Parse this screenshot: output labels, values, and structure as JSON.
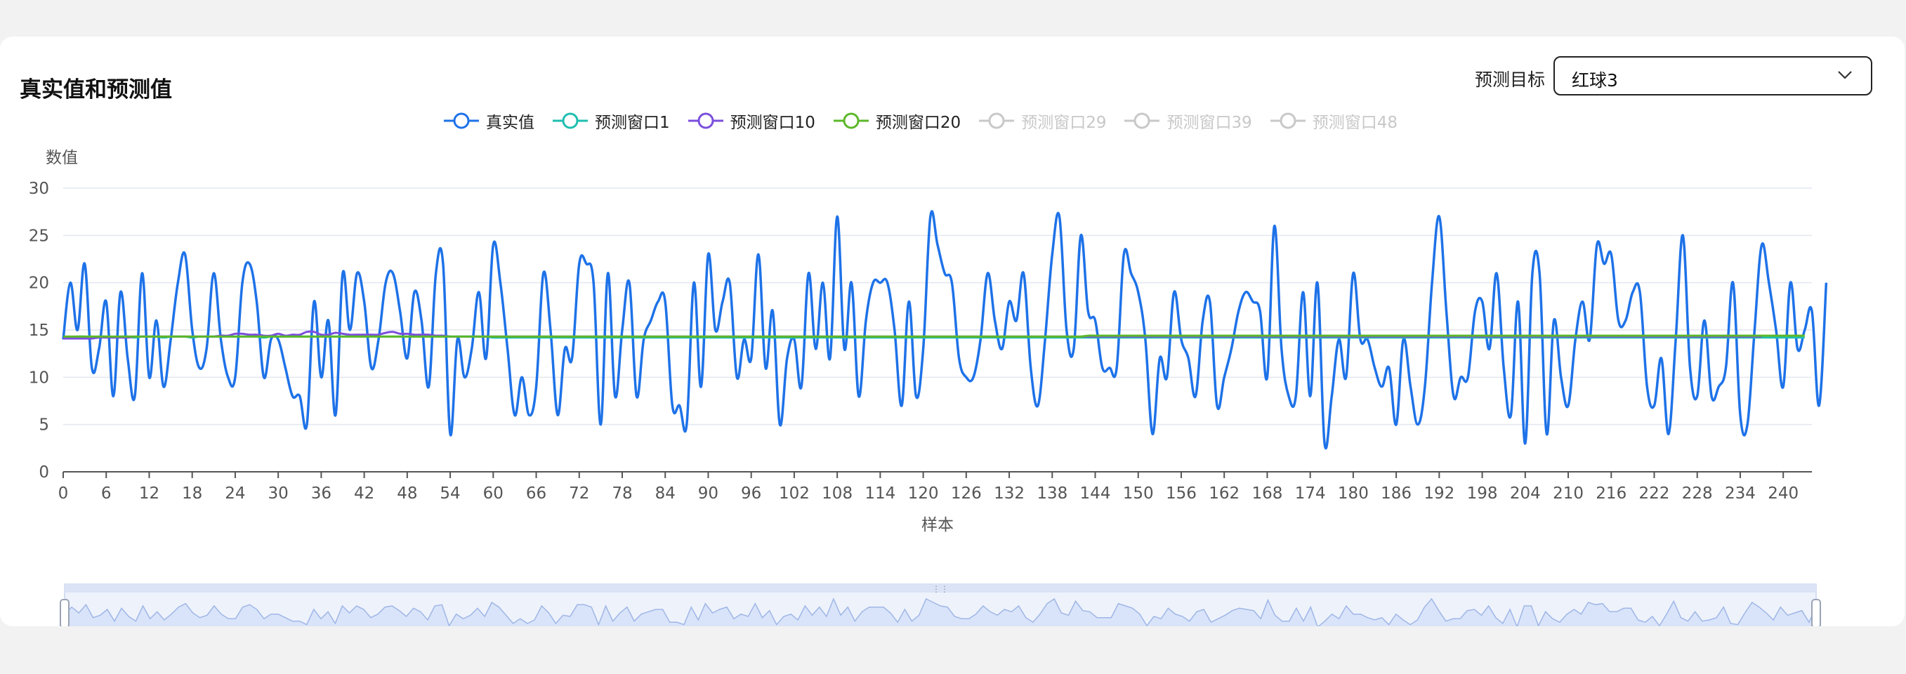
{
  "header": {
    "title": "真实值和预测值"
  },
  "target_select": {
    "label": "预测目标",
    "value": "红球3"
  },
  "colors": {
    "actual": "#1e72e8",
    "w1": "#1fbfb0",
    "w10": "#7b4fdc",
    "w20": "#5cb82a",
    "inactive": "#c8c8c8",
    "grid": "#e2e6ef",
    "axis": "#555",
    "zoom_fill": "#d9e4fa"
  },
  "legend": [
    {
      "name": "真实值",
      "color": "#1e72e8",
      "active": true
    },
    {
      "name": "预测窗口1",
      "color": "#1fbfb0",
      "active": true
    },
    {
      "name": "预测窗口10",
      "color": "#7b4fdc",
      "active": true
    },
    {
      "name": "预测窗口20",
      "color": "#5cb82a",
      "active": true
    },
    {
      "name": "预测窗口29",
      "color": "#c8c8c8",
      "active": false
    },
    {
      "name": "预测窗口39",
      "color": "#c8c8c8",
      "active": false
    },
    {
      "name": "预测窗口48",
      "color": "#c8c8c8",
      "active": false
    }
  ],
  "chart_data": {
    "type": "line",
    "title": "真实值和预测值",
    "xlabel": "样本",
    "ylabel": "数值",
    "ylim": [
      0,
      30
    ],
    "yticks": [
      0,
      5,
      10,
      15,
      20,
      25,
      30
    ],
    "xlim": [
      0,
      244
    ],
    "xticks": [
      0,
      6,
      12,
      18,
      24,
      30,
      36,
      42,
      48,
      54,
      60,
      66,
      72,
      78,
      84,
      90,
      96,
      102,
      108,
      114,
      120,
      126,
      132,
      138,
      144,
      150,
      156,
      162,
      168,
      174,
      180,
      186,
      192,
      198,
      204,
      210,
      216,
      222,
      228,
      234,
      240
    ],
    "grid": true,
    "legend_position": "top-center",
    "series": [
      {
        "name": "真实值",
        "values": [
          14,
          20,
          15,
          22,
          11,
          13,
          18,
          8,
          19,
          12,
          8,
          21,
          10,
          16,
          9,
          14,
          20,
          23,
          15,
          11,
          13,
          21,
          14,
          10,
          10,
          20,
          22,
          18,
          10,
          14,
          14,
          11,
          8,
          8,
          5,
          18,
          10,
          16,
          6,
          21,
          15,
          21,
          18,
          11,
          14,
          20,
          21,
          17,
          12,
          19,
          16,
          9,
          21,
          22,
          4,
          14,
          10,
          13,
          19,
          12,
          24,
          20,
          13,
          6,
          10,
          6,
          9,
          21,
          15,
          6,
          13,
          12,
          22,
          22,
          20,
          5,
          21,
          8,
          15,
          20,
          8,
          14,
          16,
          18,
          18,
          7,
          7,
          5,
          20,
          9,
          23,
          15,
          18,
          20,
          10,
          14,
          12,
          23,
          11,
          17,
          5,
          12,
          14,
          9,
          21,
          13,
          20,
          12,
          27,
          13,
          20,
          8,
          16,
          20,
          20,
          20,
          15,
          7,
          18,
          8,
          13,
          27,
          24,
          21,
          20,
          12,
          10,
          10,
          14,
          21,
          16,
          13,
          18,
          16,
          21,
          11,
          7,
          14,
          23,
          27,
          15,
          13,
          25,
          17,
          16,
          11,
          11,
          11,
          23,
          21,
          19,
          14,
          4,
          12,
          10,
          19,
          14,
          12,
          8,
          16,
          18,
          7,
          10,
          13,
          17,
          19,
          18,
          17,
          10,
          26,
          13,
          8,
          8,
          19,
          8,
          20,
          3,
          8,
          14,
          10,
          21,
          14,
          14,
          11,
          9,
          11,
          5,
          14,
          9,
          5,
          9,
          20,
          27,
          17,
          8,
          10,
          10,
          17,
          18,
          13,
          21,
          11,
          6,
          18,
          3,
          21,
          21,
          4,
          16,
          10,
          7,
          14,
          18,
          14,
          24,
          22,
          23,
          16,
          16,
          19,
          19,
          9,
          7,
          12,
          4,
          14,
          25,
          11,
          8,
          16,
          8,
          9,
          11,
          20,
          6,
          5,
          15,
          24,
          20,
          15,
          9,
          20,
          13,
          15,
          17,
          7,
          20
        ]
      },
      {
        "name": "预测窗口1",
        "values": [
          14.2,
          14.2,
          14.3,
          14.3,
          14.2,
          14.3,
          14.3,
          14.2,
          14.3,
          14.3,
          14.2,
          14.3,
          14.3,
          14.3,
          14.2,
          14.3,
          14.3,
          14.3,
          14.2,
          14.3,
          14.3,
          14.3,
          14.3,
          14.3,
          14.3,
          14.3,
          14.3,
          14.3,
          14.2,
          14.3,
          14.3,
          14.3,
          14.3,
          14.3,
          14.3,
          14.3,
          14.3,
          14.3,
          14.3,
          14.3,
          14.3,
          14.3,
          14.3,
          14.3,
          14.3,
          14.3,
          14.3,
          14.3,
          14.3,
          14.3,
          14.3,
          14.3,
          14.3,
          14.3,
          14.3,
          14.3,
          14.3,
          14.3,
          14.3,
          14.3,
          14.2,
          14.2,
          14.2,
          14.2,
          14.2,
          14.2,
          14.2,
          14.2,
          14.2,
          14.2,
          14.2,
          14.2,
          14.2,
          14.2,
          14.2,
          14.2,
          14.2,
          14.2,
          14.2,
          14.2,
          14.2,
          14.2,
          14.2,
          14.2,
          14.2,
          14.2,
          14.2,
          14.2,
          14.2,
          14.2,
          14.2,
          14.2,
          14.2,
          14.2,
          14.2,
          14.2,
          14.2,
          14.2,
          14.2,
          14.2,
          14.2,
          14.2,
          14.2,
          14.2,
          14.2,
          14.2,
          14.2,
          14.2,
          14.2,
          14.2,
          14.2,
          14.2,
          14.2,
          14.2,
          14.2,
          14.2,
          14.2,
          14.2,
          14.2,
          14.2,
          14.2,
          14.2,
          14.2,
          14.2,
          14.2,
          14.2,
          14.2,
          14.2,
          14.2,
          14.2,
          14.2,
          14.2,
          14.2,
          14.2,
          14.2,
          14.2,
          14.2,
          14.2,
          14.2,
          14.2,
          14.2,
          14.2,
          14.2,
          14.2,
          14.2,
          14.2,
          14.2,
          14.2,
          14.2,
          14.2,
          14.2,
          14.2,
          14.2,
          14.2,
          14.2,
          14.2,
          14.2,
          14.2,
          14.2,
          14.2,
          14.2,
          14.2,
          14.2,
          14.2,
          14.2,
          14.2,
          14.2,
          14.2,
          14.2,
          14.2,
          14.2,
          14.2,
          14.2,
          14.2,
          14.2,
          14.2,
          14.2,
          14.2,
          14.2,
          14.2,
          14.2,
          14.2,
          14.2,
          14.2,
          14.2,
          14.2,
          14.2,
          14.2,
          14.2,
          14.2,
          14.2,
          14.2,
          14.2,
          14.2,
          14.2,
          14.2,
          14.2,
          14.2,
          14.2,
          14.2,
          14.2,
          14.2,
          14.2,
          14.2,
          14.2,
          14.2,
          14.2,
          14.2,
          14.2,
          14.2,
          14.2,
          14.2,
          14.2,
          14.2,
          14.2,
          14.2,
          14.2,
          14.2,
          14.2,
          14.2,
          14.2,
          14.2,
          14.2,
          14.2,
          14.2,
          14.2,
          14.2,
          14.2,
          14.2,
          14.2,
          14.2,
          14.2,
          14.2,
          14.2,
          14.2,
          14.2,
          14.2,
          14.2,
          14.2,
          14.2,
          14.2,
          14.2,
          14.2,
          14.2
        ]
      },
      {
        "name": "预测窗口10",
        "values": [
          14.1,
          14.1,
          14.1,
          14.1,
          14.1,
          14.2,
          14.2,
          14.2,
          14.2,
          14.2,
          14.3,
          14.3,
          14.3,
          14.3,
          14.3,
          14.3,
          14.3,
          14.3,
          14.3,
          14.3,
          14.3,
          14.3,
          14.4,
          14.4,
          14.6,
          14.6,
          14.5,
          14.5,
          14.4,
          14.4,
          14.6,
          14.4,
          14.5,
          14.5,
          14.8,
          14.8,
          14.5,
          14.5,
          14.7,
          14.6,
          14.5,
          14.5,
          14.5,
          14.5,
          14.5,
          14.7,
          14.8,
          14.6,
          14.6,
          14.5,
          14.5,
          14.5,
          14.4,
          14.4,
          14.3,
          14.3,
          14.3,
          14.3,
          14.3,
          14.3,
          14.3,
          14.3,
          14.3,
          14.3,
          14.3,
          14.3,
          14.3,
          14.3,
          14.3,
          14.3,
          14.3,
          14.3,
          14.3,
          14.3,
          14.3,
          14.3,
          14.3,
          14.3,
          14.3,
          14.3,
          14.3,
          14.3,
          14.3,
          14.3,
          14.3,
          14.3,
          14.3,
          14.3,
          14.3,
          14.3,
          14.3,
          14.3,
          14.3,
          14.3,
          14.3,
          14.3,
          14.3,
          14.3,
          14.3,
          14.3,
          14.3,
          14.3,
          14.3,
          14.3,
          14.3,
          14.3,
          14.3,
          14.3,
          14.3,
          14.3,
          14.3,
          14.3,
          14.3,
          14.3,
          14.3,
          14.3,
          14.3,
          14.3,
          14.3,
          14.3,
          14.3,
          14.3,
          14.3,
          14.3,
          14.3,
          14.3,
          14.3,
          14.3,
          14.3,
          14.3,
          14.3,
          14.3,
          14.3,
          14.3,
          14.3,
          14.3,
          14.3,
          14.3,
          14.3,
          14.3,
          14.3,
          14.3,
          14.3,
          14.3,
          14.3,
          14.3,
          14.3,
          14.3,
          14.3,
          14.3,
          14.3,
          14.3,
          14.3,
          14.3,
          14.3,
          14.3,
          14.3,
          14.3,
          14.3,
          14.3,
          14.3,
          14.3,
          14.3,
          14.3,
          14.3,
          14.3,
          14.3,
          14.3,
          14.3,
          14.3,
          14.3,
          14.3,
          14.3,
          14.3,
          14.3,
          14.3,
          14.3,
          14.3,
          14.3,
          14.3,
          14.3,
          14.3,
          14.3,
          14.3,
          14.3,
          14.3,
          14.3,
          14.3,
          14.3,
          14.3,
          14.3,
          14.3,
          14.3,
          14.3,
          14.3,
          14.3,
          14.3,
          14.3,
          14.3,
          14.3,
          14.3,
          14.3,
          14.3,
          14.3,
          14.3,
          14.3,
          14.3,
          14.3,
          14.3,
          14.3,
          14.3,
          14.3,
          14.3,
          14.3,
          14.3,
          14.3,
          14.3,
          14.3,
          14.3,
          14.3,
          14.3,
          14.3,
          14.3,
          14.3,
          14.3,
          14.3,
          14.3,
          14.3,
          14.3,
          14.3,
          14.3,
          14.3,
          14.3,
          14.3,
          14.3,
          14.3,
          14.3,
          14.3
        ]
      },
      {
        "name": "预测窗口20",
        "values": [
          14.3,
          14.3,
          14.3,
          14.3,
          14.3,
          14.3,
          14.3,
          14.3,
          14.3,
          14.3,
          14.3,
          14.3,
          14.3,
          14.3,
          14.3,
          14.3,
          14.3,
          14.3,
          14.3,
          14.3,
          14.3,
          14.3,
          14.3,
          14.3,
          14.3,
          14.3,
          14.3,
          14.3,
          14.3,
          14.3,
          14.3,
          14.3,
          14.3,
          14.3,
          14.3,
          14.3,
          14.3,
          14.3,
          14.3,
          14.3,
          14.3,
          14.3,
          14.3,
          14.3,
          14.3,
          14.3,
          14.3,
          14.3,
          14.3,
          14.3,
          14.3,
          14.3,
          14.3,
          14.3,
          14.3,
          14.3,
          14.3,
          14.3,
          14.3,
          14.3,
          14.3,
          14.3,
          14.3,
          14.3,
          14.3,
          14.3,
          14.3,
          14.3,
          14.3,
          14.3,
          14.3,
          14.3,
          14.3,
          14.3,
          14.3,
          14.3,
          14.3,
          14.3,
          14.3,
          14.3,
          14.3,
          14.3,
          14.3,
          14.3,
          14.3,
          14.3,
          14.3,
          14.3,
          14.3,
          14.3,
          14.3,
          14.3,
          14.3,
          14.3,
          14.3,
          14.3,
          14.3,
          14.3,
          14.3,
          14.3,
          14.3,
          14.3,
          14.3,
          14.3,
          14.3,
          14.3,
          14.3,
          14.3,
          14.3,
          14.3,
          14.3,
          14.3,
          14.3,
          14.3,
          14.3,
          14.3,
          14.3,
          14.3,
          14.3,
          14.3,
          14.3,
          14.3,
          14.3,
          14.3,
          14.3,
          14.3,
          14.3,
          14.3,
          14.3,
          14.3,
          14.3,
          14.3,
          14.3,
          14.3,
          14.3,
          14.3,
          14.3,
          14.3,
          14.3,
          14.3,
          14.3,
          14.3,
          14.3,
          14.4,
          14.4,
          14.4,
          14.4,
          14.4,
          14.4,
          14.4,
          14.4,
          14.4,
          14.4,
          14.4,
          14.4,
          14.4,
          14.4,
          14.4,
          14.4,
          14.4,
          14.4,
          14.4,
          14.4,
          14.4,
          14.4,
          14.4,
          14.4,
          14.4,
          14.4,
          14.4,
          14.4,
          14.4,
          14.4,
          14.4,
          14.4,
          14.4,
          14.4,
          14.4,
          14.4,
          14.4,
          14.4,
          14.4,
          14.4,
          14.4,
          14.4,
          14.4,
          14.4,
          14.4,
          14.4,
          14.4,
          14.4,
          14.4,
          14.4,
          14.4,
          14.4,
          14.4,
          14.4,
          14.4,
          14.4,
          14.4,
          14.4,
          14.4,
          14.4,
          14.4,
          14.4,
          14.4,
          14.4,
          14.4,
          14.4,
          14.4,
          14.4,
          14.4,
          14.4,
          14.4,
          14.4,
          14.4,
          14.4,
          14.4,
          14.4,
          14.4,
          14.4,
          14.4,
          14.4,
          14.4,
          14.4,
          14.4,
          14.4,
          14.4,
          14.4,
          14.4,
          14.4,
          14.4,
          14.4,
          14.4,
          14.4,
          14.4,
          14.4,
          14.4,
          14.4,
          14.4,
          14.4,
          14.4,
          14.4,
          14.4
        ]
      }
    ]
  }
}
